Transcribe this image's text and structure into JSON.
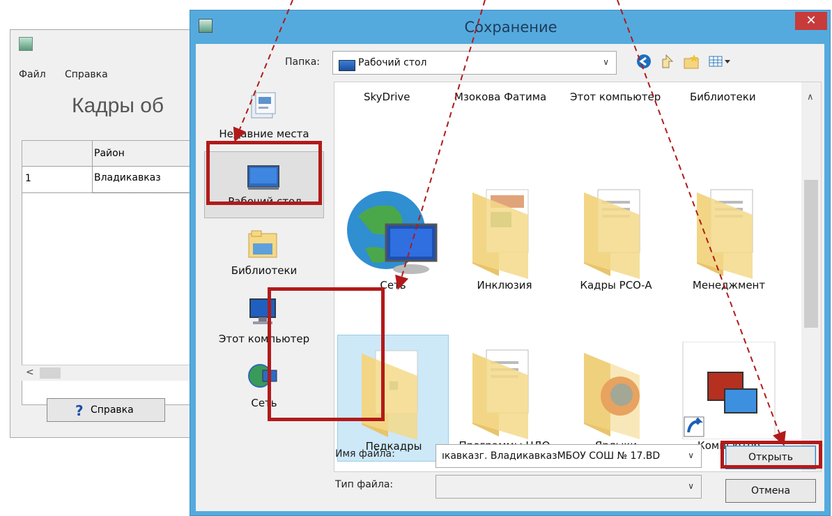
{
  "background_app": {
    "menu": [
      "Файл",
      "Справка"
    ],
    "heading": "Кадры об",
    "table": {
      "column_header": "Район",
      "rows": [
        {
          "num": "1",
          "value": "Владикавказ"
        }
      ]
    },
    "scroll_left": "<",
    "help_button": {
      "icon": "?",
      "label": "Справка"
    }
  },
  "dialog": {
    "title": "Сохранение",
    "close_glyph": "✕",
    "folder_label": "Папка:",
    "folder_value": "Рабочий стол",
    "toolbar_icons": [
      "back-icon",
      "up-folder-icon",
      "new-folder-icon",
      "view-menu-icon"
    ],
    "places": [
      {
        "label": "Недавние места",
        "icon": "recent-places-icon",
        "selected": false
      },
      {
        "label": "Рабочий стол",
        "icon": "desktop-icon",
        "selected": true
      },
      {
        "label": "Библиотеки",
        "icon": "libraries-icon",
        "selected": false
      },
      {
        "label": "Этот компьютер",
        "icon": "computer-icon",
        "selected": false
      },
      {
        "label": "Сеть",
        "icon": "network-icon",
        "selected": false
      }
    ],
    "top_row_labels": [
      "SkyDrive",
      "Мзокова Фатима",
      "Этот компьютер",
      "Библиотеки"
    ],
    "items": [
      {
        "name": "Сеть",
        "icon": "network-globe-icon",
        "selected": false
      },
      {
        "name": "Инклюзия",
        "icon": "folder-icon",
        "selected": false
      },
      {
        "name": "Кадры РСО-А",
        "icon": "folder-icon",
        "selected": false
      },
      {
        "name": "Менеджмент",
        "icon": "folder-icon",
        "selected": false
      },
      {
        "name": "Пeдкадры",
        "icon": "folder-icon",
        "selected": true
      },
      {
        "name": "Программы ЦДО",
        "icon": "folder-icon",
        "selected": false
      },
      {
        "name": "Ярлыки",
        "icon": "folder-icon",
        "selected": false
      },
      {
        "name": "Компьютер",
        "icon": "computer-shortcut-icon",
        "selected": false
      }
    ],
    "filename_label": "Имя файла:",
    "filename_value": "ıкавказг. ВладикавказМБОУ СОШ № 17.BD",
    "filetype_label": "Тип файла:",
    "filetype_value": "",
    "open_button": "Открыть",
    "cancel_button": "Отмена"
  },
  "colors": {
    "annotation_red": "#b21a1a",
    "dialog_frame": "#55aadd",
    "close_button": "#c73b3b",
    "selection_blue": "#cde8f7"
  }
}
